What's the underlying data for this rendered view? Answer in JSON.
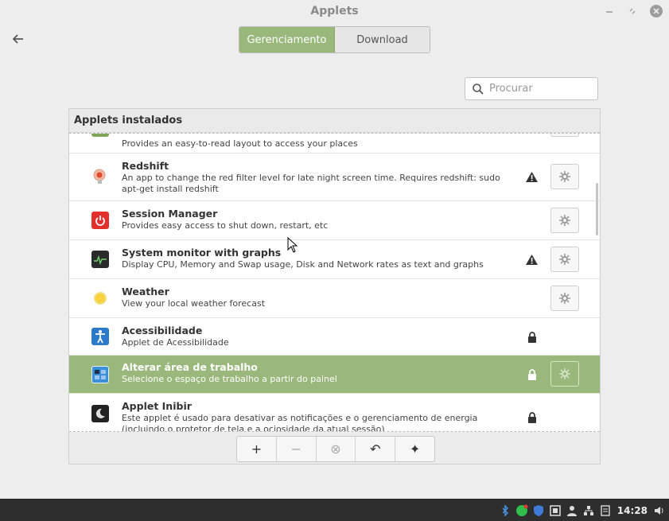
{
  "window": {
    "title": "Applets",
    "min_icon": "minimize-icon",
    "max_icon": "maximize-icon",
    "close_icon": "close-icon"
  },
  "tabs": [
    {
      "label": "Gerenciamento",
      "active": true
    },
    {
      "label": "Download",
      "active": false
    }
  ],
  "search": {
    "placeholder": "Procurar"
  },
  "panel": {
    "title": "Applets instalados"
  },
  "applets": [
    {
      "name": "",
      "description": "Provides an easy-to-read layout to access your places",
      "icon": "places-icon",
      "warning": false,
      "locked": false,
      "configurable": true
    },
    {
      "name": "Redshift",
      "description": "An app to change the red filter level for late night screen time. Requires redshift: sudo apt-get install redshift",
      "icon": "redshift-icon",
      "warning": true,
      "locked": false,
      "configurable": true
    },
    {
      "name": "Session Manager",
      "description": "Provides easy access to shut down, restart, etc",
      "icon": "power-icon",
      "warning": false,
      "locked": false,
      "configurable": true
    },
    {
      "name": "System monitor with graphs",
      "description": "Display CPU, Memory and Swap usage, Disk and Network rates as text and graphs",
      "icon": "system-monitor-icon",
      "warning": true,
      "locked": false,
      "configurable": true
    },
    {
      "name": "Weather",
      "description": "View your local weather forecast",
      "icon": "weather-sun-icon",
      "warning": false,
      "locked": false,
      "configurable": true
    },
    {
      "name": "Acessibilidade",
      "description": "Applet de Acessibilidade",
      "icon": "accessibility-icon",
      "warning": false,
      "locked": true,
      "configurable": false
    },
    {
      "name": "Alterar área de trabalho",
      "description": "Selecione o espaço de trabalho a partir do painel",
      "icon": "workspace-switcher-icon",
      "warning": false,
      "locked": true,
      "configurable": true,
      "selected": true
    },
    {
      "name": "Applet Inibir",
      "description": "Este applet é usado para desativar as notificações e o gerenciamento de energia (incluindo o protetor de tela e a ociosidade da atual sessão)",
      "icon": "inhibit-moon-icon",
      "warning": false,
      "locked": true,
      "configurable": false
    }
  ],
  "toolbar": {
    "buttons": [
      {
        "label": "+",
        "icon": "add-icon",
        "enabled": true
      },
      {
        "label": "−",
        "icon": "remove-icon",
        "enabled": false
      },
      {
        "label": "⊗",
        "icon": "clear-icon",
        "enabled": false
      },
      {
        "label": "↶",
        "icon": "undo-icon",
        "enabled": true
      },
      {
        "label": "✦",
        "icon": "more-icon",
        "enabled": true
      }
    ]
  },
  "taskbar": {
    "clock": "14:28",
    "tray": [
      "bluetooth-icon",
      "whatsapp-icon",
      "shield-icon",
      "clipboard-icon",
      "user-icon",
      "network-icon",
      "notes-icon",
      "volume-icon"
    ]
  },
  "colors": {
    "accent": "#9ab87c",
    "taskbar": "#2e2e2e"
  }
}
